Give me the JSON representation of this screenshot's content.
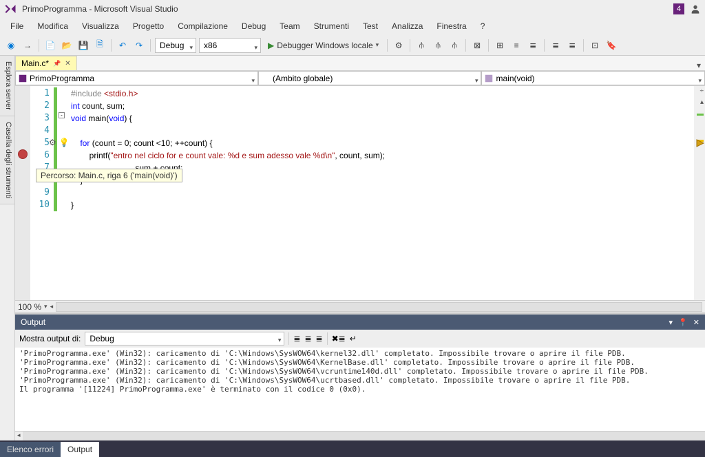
{
  "title": "PrimoProgramma - Microsoft Visual Studio",
  "notif_badge": "4",
  "menus": [
    "File",
    "Modifica",
    "Visualizza",
    "Progetto",
    "Compilazione",
    "Debug",
    "Team",
    "Strumenti",
    "Test",
    "Analizza",
    "Finestra",
    "?"
  ],
  "toolbar": {
    "config": "Debug",
    "platform": "x86",
    "start_label": "Debugger Windows locale"
  },
  "sidebar": {
    "tabs": [
      "Esplora server",
      "Casella degli strumenti"
    ]
  },
  "editor": {
    "tab": {
      "name": "Main.c*",
      "pinned": true
    },
    "nav": {
      "project": "PrimoProgramma",
      "scope": "(Ambito globale)",
      "func": "main(void)"
    },
    "lines": [
      {
        "n": 1,
        "html": "<span class='inc'>#include </span><span class='incf'>&lt;stdio.h&gt;</span>"
      },
      {
        "n": 2,
        "html": "<span class='kw'>int</span> count, sum;"
      },
      {
        "n": 3,
        "html": "<span class='kw'>void</span> main(<span class='kw'>void</span>) {"
      },
      {
        "n": 4,
        "html": ""
      },
      {
        "n": 5,
        "html": "    <span class='kw'>for</span> (count = 0; count &lt;10; ++count) {"
      },
      {
        "n": 6,
        "html": "        printf(<span class='str'>\"entro nel ciclo for e count vale: %d e sum adesso vale %d\\n\"</span>, count, sum);"
      },
      {
        "n": 7,
        "html": "                            sum + count;"
      },
      {
        "n": 8,
        "html": "    }"
      },
      {
        "n": 9,
        "html": ""
      },
      {
        "n": 10,
        "html": "}"
      }
    ],
    "breakpoint_line": 6,
    "tooltip": "Percorso: Main.c, riga 6 ('main(void)')",
    "zoom": "100 %"
  },
  "output": {
    "title": "Output",
    "filter_label": "Mostra output di:",
    "filter_value": "Debug",
    "lines": [
      "'PrimoProgramma.exe' (Win32): caricamento di 'C:\\Windows\\SysWOW64\\kernel32.dll' completato. Impossibile trovare o aprire il file PDB.",
      "'PrimoProgramma.exe' (Win32): caricamento di 'C:\\Windows\\SysWOW64\\KernelBase.dll' completato. Impossibile trovare o aprire il file PDB.",
      "'PrimoProgramma.exe' (Win32): caricamento di 'C:\\Windows\\SysWOW64\\vcruntime140d.dll' completato. Impossibile trovare o aprire il file PDB.",
      "'PrimoProgramma.exe' (Win32): caricamento di 'C:\\Windows\\SysWOW64\\ucrtbased.dll' completato. Impossibile trovare o aprire il file PDB.",
      "Il programma '[11224] PrimoProgramma.exe' è terminato con il codice 0 (0x0)."
    ]
  },
  "bottom": {
    "tabs": [
      "Elenco errori",
      "Output"
    ],
    "active": 1
  }
}
